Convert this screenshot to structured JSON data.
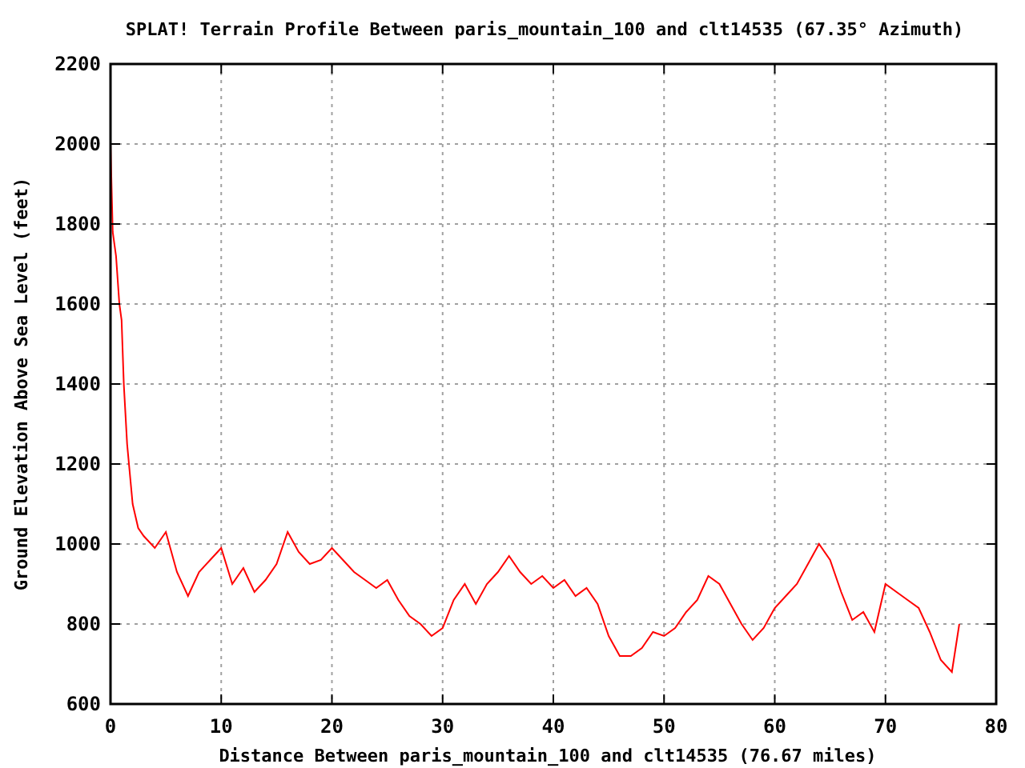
{
  "chart_data": {
    "type": "line",
    "title": "SPLAT! Terrain Profile Between paris_mountain_100 and clt14535 (67.35° Azimuth)",
    "xlabel": "Distance Between paris_mountain_100 and clt14535 (76.67 miles)",
    "ylabel": "Ground Elevation Above Sea Level (feet)",
    "x": [
      0,
      0.2,
      0.5,
      0.8,
      1,
      1.2,
      1.5,
      2,
      2.5,
      3,
      4,
      5,
      6,
      7,
      8,
      9,
      10,
      11,
      12,
      13,
      14,
      15,
      16,
      17,
      18,
      19,
      20,
      21,
      22,
      23,
      24,
      25,
      26,
      27,
      28,
      29,
      30,
      31,
      32,
      33,
      34,
      35,
      36,
      37,
      38,
      39,
      40,
      41,
      42,
      43,
      44,
      45,
      46,
      47,
      48,
      49,
      50,
      51,
      52,
      53,
      54,
      55,
      56,
      57,
      58,
      59,
      60,
      61,
      62,
      63,
      64,
      65,
      66,
      67,
      68,
      69,
      70,
      71,
      72,
      73,
      74,
      75,
      76,
      76.67
    ],
    "grid": true,
    "series": [
      {
        "color": "#ff0000",
        "values": [
          2000,
          1780,
          1720,
          1600,
          1560,
          1400,
          1250,
          1100,
          1040,
          1020,
          990,
          1030,
          930,
          870,
          930,
          960,
          990,
          900,
          940,
          880,
          910,
          950,
          1030,
          980,
          950,
          960,
          990,
          960,
          930,
          910,
          890,
          910,
          860,
          820,
          800,
          770,
          790,
          860,
          900,
          850,
          900,
          930,
          970,
          930,
          900,
          920,
          890,
          910,
          870,
          890,
          850,
          770,
          720,
          720,
          740,
          780,
          770,
          790,
          830,
          860,
          920,
          900,
          850,
          800,
          760,
          790,
          840,
          870,
          900,
          950,
          1000,
          960,
          880,
          810,
          830,
          780,
          900,
          880,
          860,
          840,
          780,
          710,
          680,
          800
        ]
      }
    ],
    "xlim": [
      0,
      80
    ],
    "ylim": [
      600,
      2200
    ],
    "xticks": [
      0,
      10,
      20,
      30,
      40,
      50,
      60,
      70,
      80
    ],
    "yticks": [
      600,
      800,
      1000,
      1200,
      1400,
      1600,
      1800,
      2000,
      2200
    ]
  }
}
